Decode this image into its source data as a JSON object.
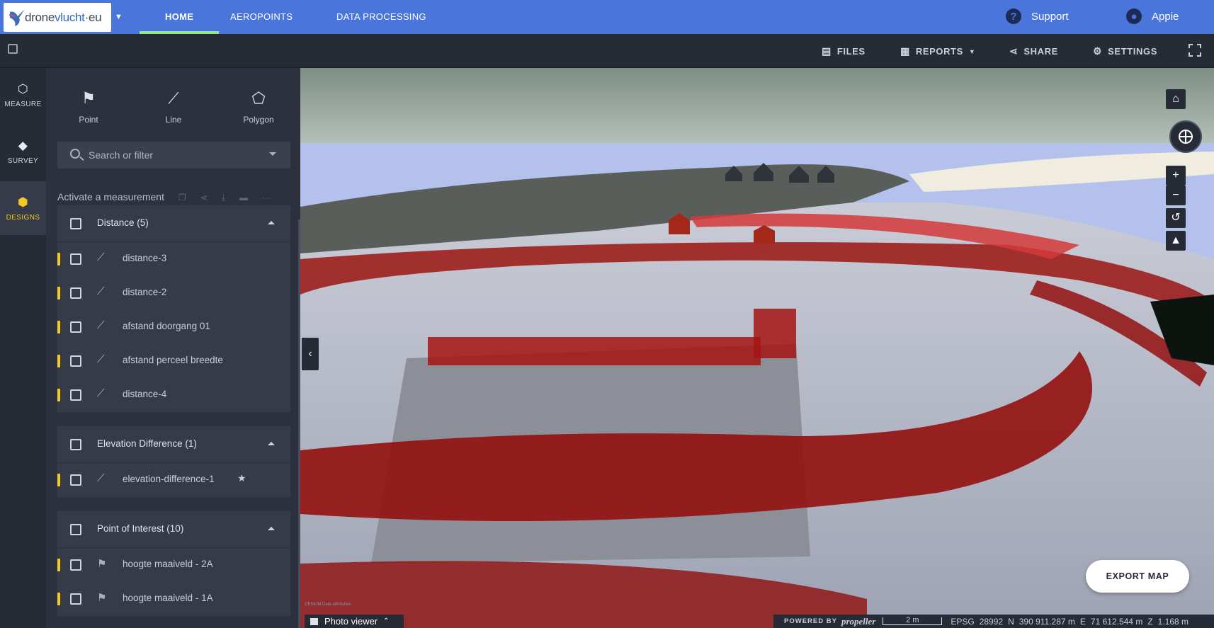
{
  "app": {
    "logo_prefix": "drone",
    "logo_main": "vlucht",
    "logo_suffix": "·eu"
  },
  "nav": {
    "tabs": [
      {
        "label": "HOME",
        "active": true
      },
      {
        "label": "AEROPOINTS",
        "active": false
      },
      {
        "label": "DATA PROCESSING",
        "active": false
      }
    ],
    "support_label": "Support",
    "user_label": "Appie"
  },
  "toolbar": {
    "files": "FILES",
    "reports": "REPORTS",
    "share": "SHARE",
    "settings": "SETTINGS"
  },
  "rail": {
    "items": [
      {
        "label": "MEASURE",
        "icon": "hexagon-icon"
      },
      {
        "label": "SURVEY",
        "icon": "layers-icon"
      },
      {
        "label": "DESIGNS",
        "icon": "cube-icon",
        "active": true
      }
    ]
  },
  "tools": {
    "point": "Point",
    "line": "Line",
    "polygon": "Polygon"
  },
  "search": {
    "placeholder": "Search or filter"
  },
  "activate_label": "Activate a measurement",
  "groups": [
    {
      "title": "Distance (5)",
      "items": [
        "distance-3",
        "distance-2",
        "afstand doorgang 01",
        "afstand perceel breedte",
        "distance-4"
      ]
    },
    {
      "title": "Elevation Difference (1)",
      "items": [
        "elevation-difference-1"
      ]
    },
    {
      "title": "Point of Interest (10)",
      "items": [
        "hoogte maaiveld - 2A",
        "hoogte maaiveld - 1A"
      ]
    }
  ],
  "map": {
    "export_label": "EXPORT MAP",
    "photo_viewer": "Photo viewer",
    "attribution": "CESIUM   Data attribution"
  },
  "status": {
    "powered_by": "POWERED BY",
    "provider": "propeller",
    "scale": "2 m",
    "epsg_label": "EPSG",
    "epsg_value": "28992",
    "n_label": "N",
    "n_value": "390 911.287 m",
    "e_label": "E",
    "e_value": "71 612.544 m",
    "z_label": "Z",
    "z_value": "1.168 m"
  }
}
